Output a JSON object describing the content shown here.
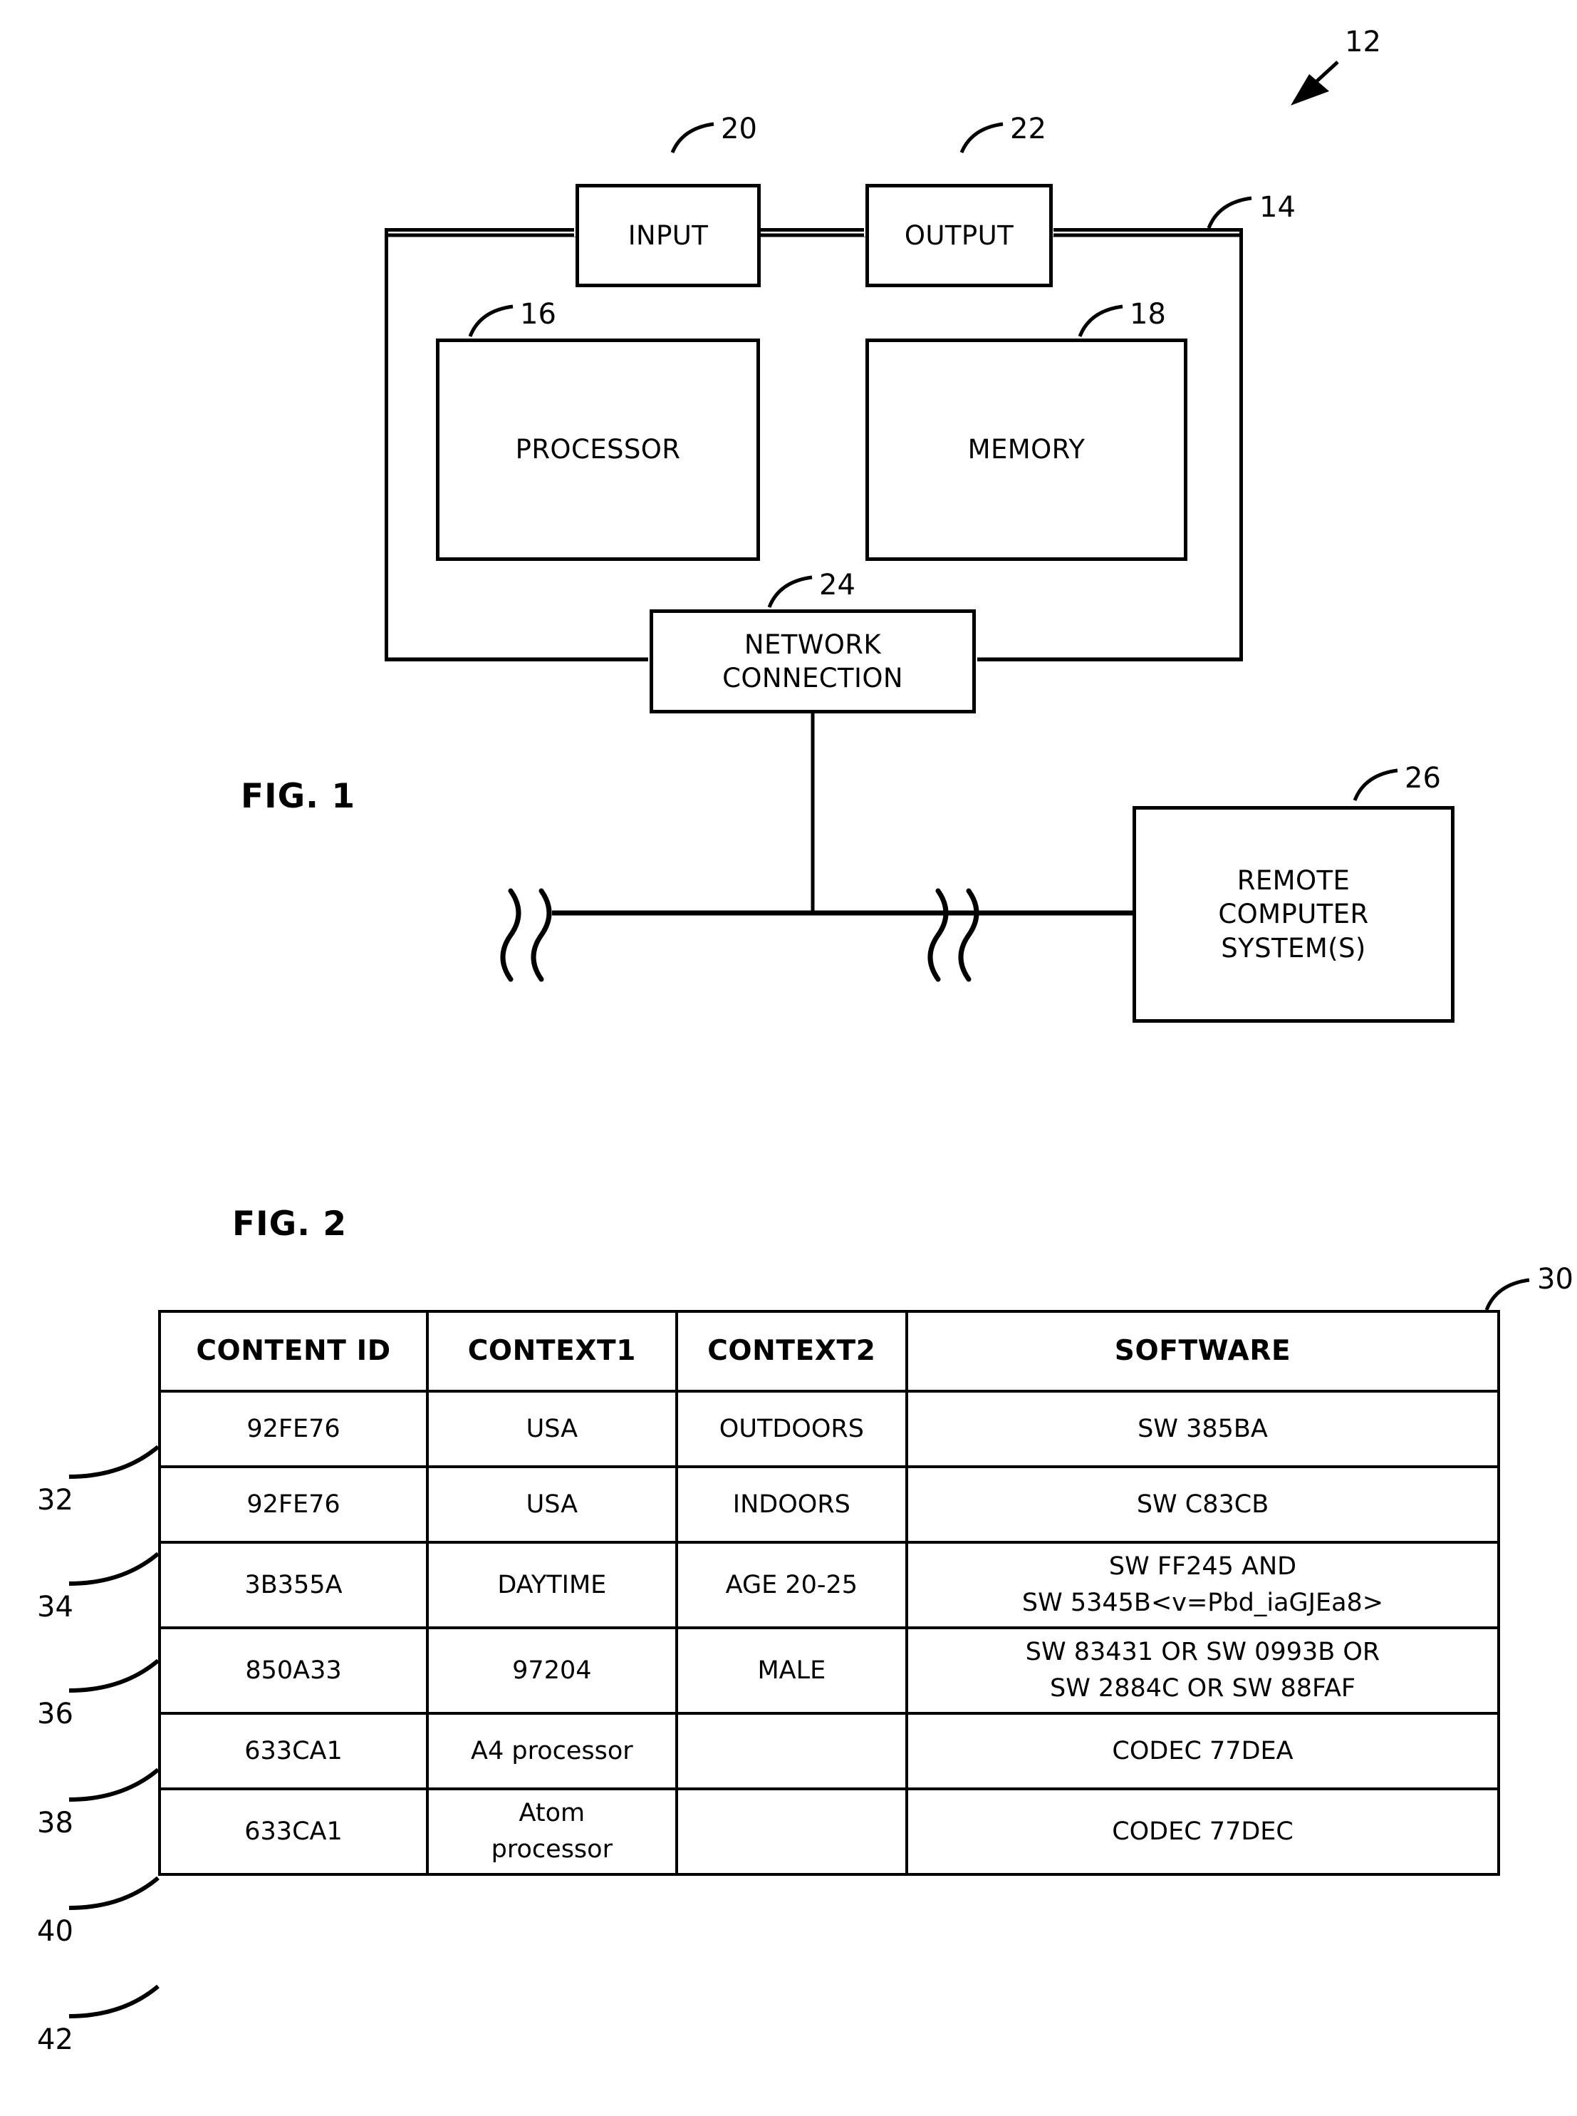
{
  "figure1": {
    "title": "FIG. 1",
    "reference_numerals": {
      "system": "12",
      "computer_system": "14",
      "processor": "16",
      "memory": "18",
      "input": "20",
      "output": "22",
      "network_connection": "24",
      "remote": "26"
    },
    "blocks": {
      "input": "INPUT",
      "output": "OUTPUT",
      "processor": "PROCESSOR",
      "memory": "MEMORY",
      "network_connection_line1": "NETWORK",
      "network_connection_line2": "CONNECTION",
      "remote_line1": "REMOTE",
      "remote_line2": "COMPUTER",
      "remote_line3": "SYSTEM(S)"
    }
  },
  "figure2": {
    "title": "FIG. 2",
    "table_reference": "30",
    "row_references": [
      "32",
      "34",
      "36",
      "38",
      "40",
      "42"
    ],
    "table": {
      "headers": [
        "CONTENT ID",
        "CONTEXT1",
        "CONTEXT2",
        "SOFTWARE"
      ],
      "rows": [
        {
          "ref": "32",
          "content_id": "92FE76",
          "context1": "USA",
          "context2": "OUTDOORS",
          "software": "SW 385BA"
        },
        {
          "ref": "34",
          "content_id": "92FE76",
          "context1": "USA",
          "context2": "INDOORS",
          "software": "SW C83CB"
        },
        {
          "ref": "36",
          "content_id": "3B355A",
          "context1": "DAYTIME",
          "context2": "AGE 20-25",
          "software": "SW FF245 AND\nSW 5345B<v=Pbd_iaGJEa8>"
        },
        {
          "ref": "38",
          "content_id": "850A33",
          "context1": "97204",
          "context2": "MALE",
          "software": "SW 83431 OR SW 0993B OR\nSW 2884C OR SW 88FAF"
        },
        {
          "ref": "40",
          "content_id": "633CA1",
          "context1": "A4 processor",
          "context2": "",
          "software": "CODEC 77DEA"
        },
        {
          "ref": "42",
          "content_id": "633CA1",
          "context1": "Atom\nprocessor",
          "context2": "",
          "software": "CODEC 77DEC"
        }
      ]
    }
  },
  "colors": {
    "line": "#000000",
    "background": "#ffffff"
  }
}
